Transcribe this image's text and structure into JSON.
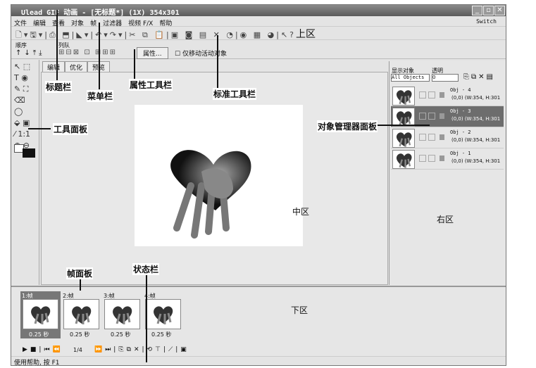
{
  "window": {
    "title": "Ulead GIF 动画 - [无标题*] (1X) 354x301",
    "switch": "Switch"
  },
  "menu": [
    "文件",
    "编辑",
    "查看",
    "对象",
    "帧",
    "过滤器",
    "视频 F/X",
    "帮助"
  ],
  "props": {
    "order_label": "顺序",
    "queue_label": "列队",
    "attr_button": "属性...",
    "move_only": "仅移动活动对象"
  },
  "tabs": [
    "编辑",
    "优化",
    "预览"
  ],
  "tools": {
    "zoom": "1:1"
  },
  "objects": {
    "show_label": "显示对象",
    "trans_label": "透明",
    "show_value": "All Objects",
    "trans_value": "0",
    "items": [
      {
        "name": "Obj - 4",
        "info": "(0,0) (W:354, H:301"
      },
      {
        "name": "Obj - 3",
        "info": "(0,0) (W:354, H:301"
      },
      {
        "name": "Obj - 2",
        "info": "(0,0) (W:354, H:301"
      },
      {
        "name": "Obj - 1",
        "info": "(0,0) (W:354, H:301"
      }
    ]
  },
  "frames": [
    {
      "label": "1:帧",
      "delay": "0.25 秒"
    },
    {
      "label": "2:帧",
      "delay": "0.25 秒"
    },
    {
      "label": "3:帧",
      "delay": "0.25 秒"
    },
    {
      "label": "4:帧",
      "delay": "0.25 秒"
    }
  ],
  "player": {
    "position": "1/4"
  },
  "status": "使用帮助, 按 F1",
  "annotations": {
    "top": "上区",
    "title": "标题栏",
    "menu": "菜单栏",
    "props": "属性工具栏",
    "std": "标准工具栏",
    "tools": "工具面板",
    "objmgr": "对象管理器面板",
    "middle": "中区",
    "right": "右区",
    "frame": "帧面板",
    "status": "状态栏",
    "bottom": "下区"
  }
}
